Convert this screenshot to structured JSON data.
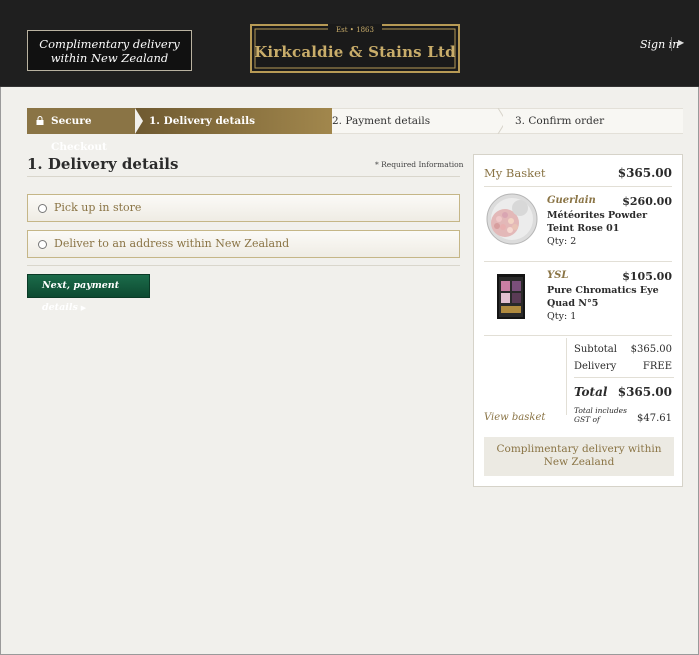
{
  "header": {
    "promo": "Complimentary delivery within New Zealand",
    "logo": {
      "est": "Est • 1863",
      "name": "Kirkcaldie & Stains Ltd"
    },
    "signin": "Sign in"
  },
  "progress": {
    "secure": "Secure Checkout",
    "steps": [
      "1. Delivery details",
      "2. Payment details",
      "3. Confirm order"
    ]
  },
  "delivery": {
    "title": "1. Delivery details",
    "required": "* Required Information",
    "options": [
      "Pick up in store",
      "Deliver to an address within New Zealand"
    ],
    "next_button": "Next, payment details"
  },
  "basket": {
    "title": "My Basket",
    "total_top": "$365.00",
    "items": [
      {
        "brand": "Guerlain",
        "price": "$260.00",
        "name": "Météorites Powder Teint Rose 01",
        "qty": "Qty: 2"
      },
      {
        "brand": "YSL",
        "price": "$105.00",
        "name": "Pure Chromatics Eye Quad N°5",
        "qty": "Qty: 1"
      }
    ],
    "subtotal_label": "Subtotal",
    "subtotal": "$365.00",
    "delivery_label": "Delivery",
    "delivery": "FREE",
    "total_label": "Total",
    "total": "$365.00",
    "view_basket": "View basket",
    "gst_label": "Total includes GST of",
    "gst": "$47.61",
    "promo": "Complimentary delivery within New Zealand"
  },
  "colors": {
    "accent": "#8a7445",
    "header_bg": "#1f1f1f",
    "button_green": "#0d4a31",
    "page_bg": "#f1f0ec"
  }
}
